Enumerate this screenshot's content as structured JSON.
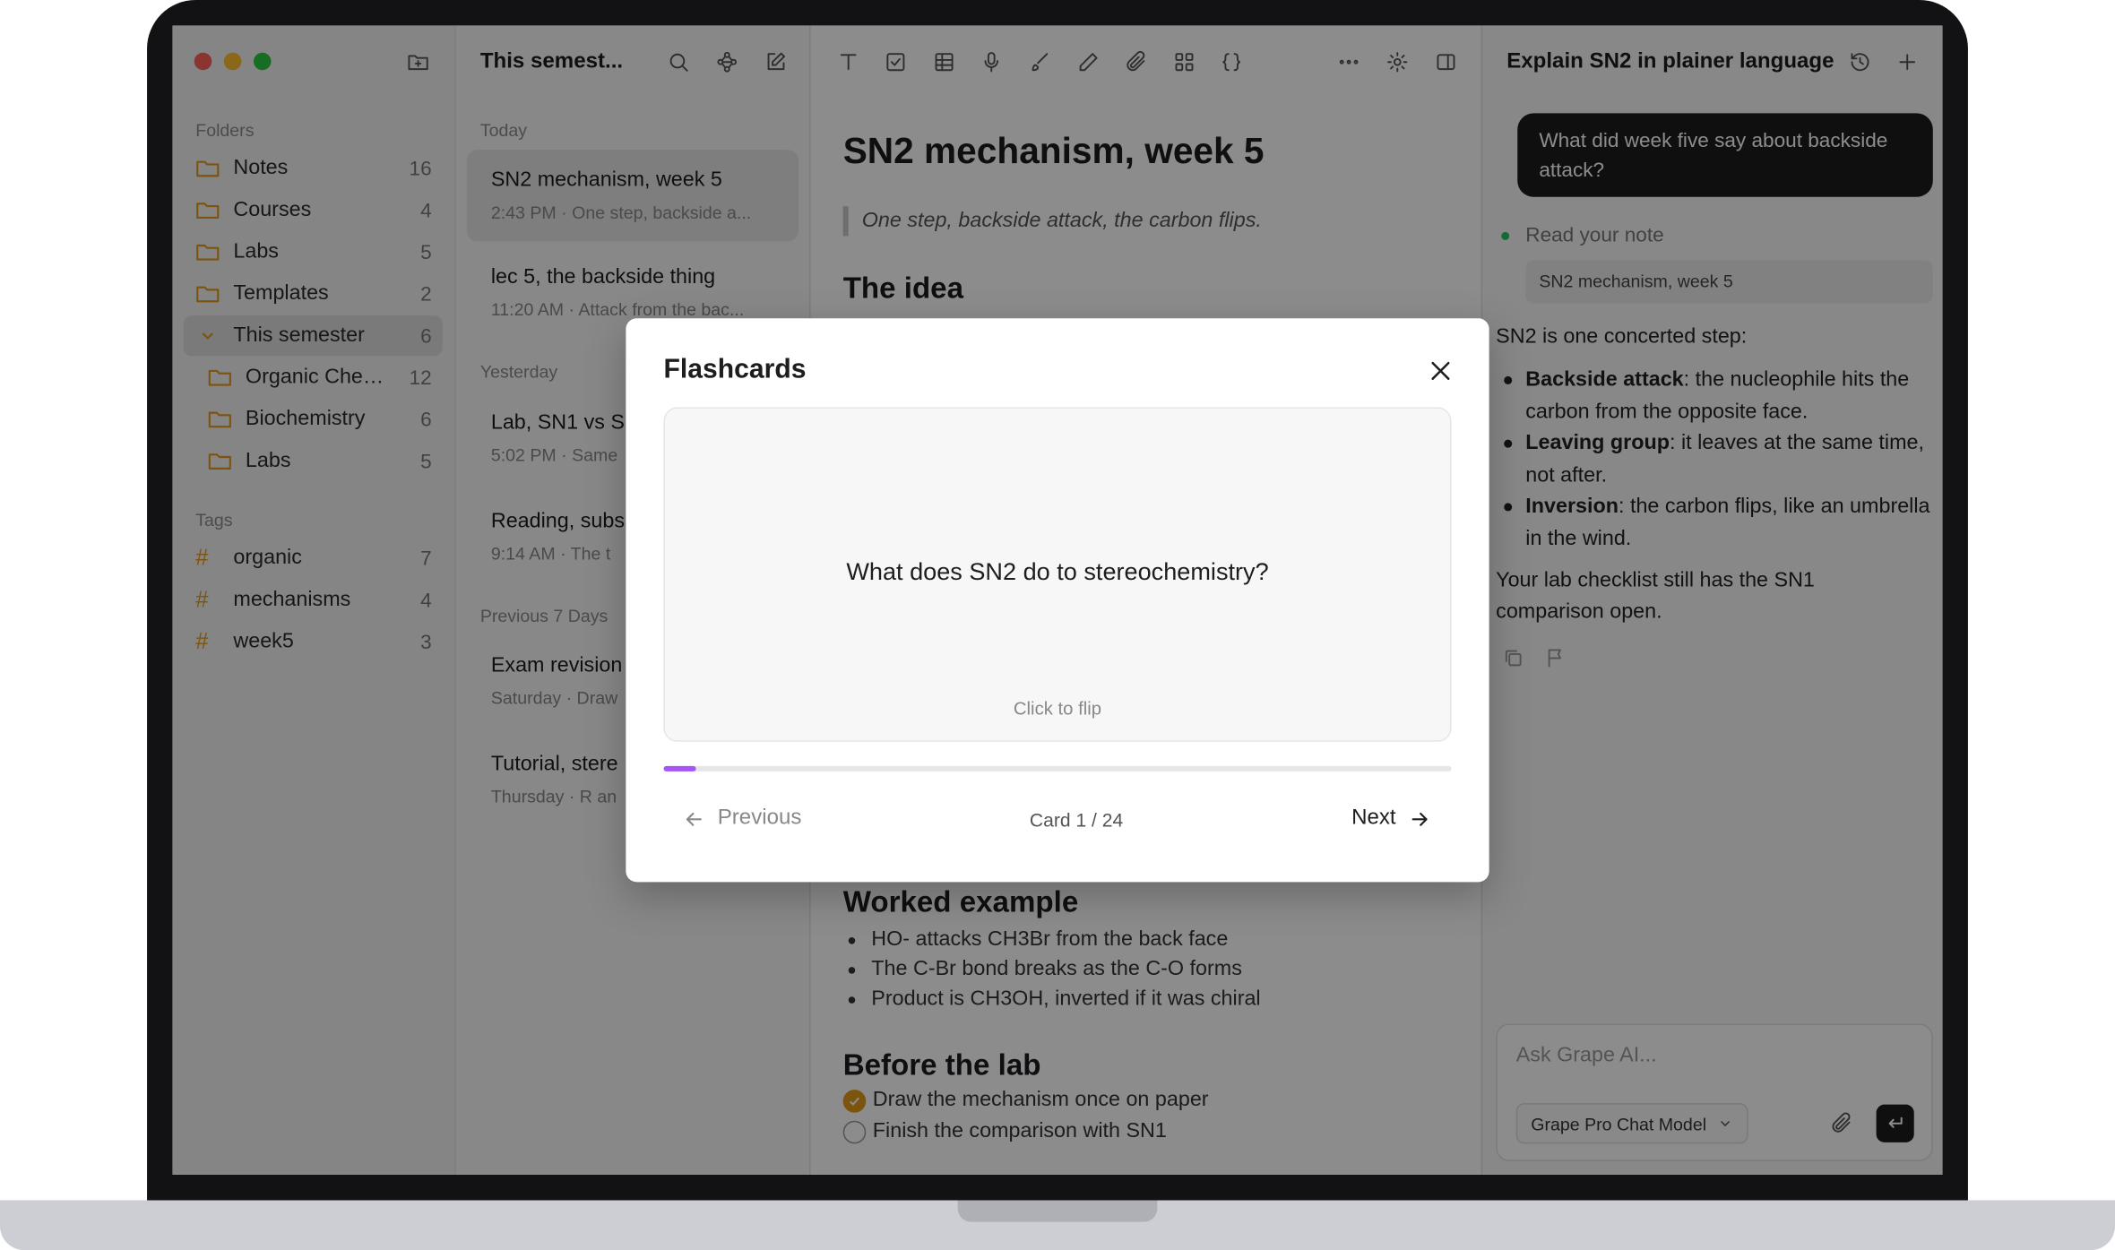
{
  "window": {
    "title": "This semest..."
  },
  "sidebar": {
    "folders_label": "Folders",
    "folders": [
      {
        "name": "Notes",
        "count": "16"
      },
      {
        "name": "Courses",
        "count": "4"
      },
      {
        "name": "Labs",
        "count": "5"
      },
      {
        "name": "Templates",
        "count": "2"
      },
      {
        "name": "This semester",
        "count": "6"
      },
      {
        "name": "Organic Chemi...",
        "count": "12"
      },
      {
        "name": "Biochemistry",
        "count": "6"
      },
      {
        "name": "Labs",
        "count": "5"
      }
    ],
    "tags_label": "Tags",
    "tags": [
      {
        "name": "organic",
        "count": "7"
      },
      {
        "name": "mechanisms",
        "count": "4"
      },
      {
        "name": "week5",
        "count": "3"
      }
    ]
  },
  "notes": {
    "groups": [
      "Today",
      "Yesterday",
      "Previous 7 Days"
    ],
    "items": [
      {
        "title": "SN2 mechanism, week 5",
        "meta": "2:43 PM · One step, backside a..."
      },
      {
        "title": "lec 5, the backside thing",
        "meta": "11:20 AM · Attack from the bac..."
      },
      {
        "title": "Lab, SN1 vs S",
        "meta": "5:02 PM · Same"
      },
      {
        "title": "Reading, subs",
        "meta": "9:14 AM · The t"
      },
      {
        "title": "Exam revision",
        "meta": "Saturday · Draw"
      },
      {
        "title": "Tutorial, stere",
        "meta": "Thursday · R an"
      }
    ]
  },
  "editor": {
    "title": "SN2 mechanism, week 5",
    "quote": "One step, backside attack, the carbon flips.",
    "h_idea": "The idea",
    "h_worked": "Worked example",
    "worked": [
      "HO- attacks CH3Br from the back face",
      "The C-Br bond breaks as the C-O forms",
      "Product is CH3OH, inverted if it was chiral"
    ],
    "h_before": "Before the lab",
    "checklist": [
      {
        "text": "Draw the mechanism once on paper",
        "done": true
      },
      {
        "text": "Finish the comparison with SN1",
        "done": false
      }
    ]
  },
  "chat": {
    "title": "Explain SN2 in plainer language",
    "user_msg": "What did week five say about backside attack?",
    "tool_label": "Read your note",
    "tool_ref": "SN2 mechanism, week 5",
    "intro": "SN2 is one concerted step:",
    "bullets": [
      {
        "b": "Backside attack",
        "t": ": the nucleophile hits the carbon from the opposite face."
      },
      {
        "b": "Leaving group",
        "t": ": it leaves at the same time, not after."
      },
      {
        "b": "Inversion",
        "t": ": the carbon flips, like an umbrella in the wind."
      }
    ],
    "outro": "Your lab checklist still has the SN1 comparison open.",
    "input_placeholder": "Ask Grape AI...",
    "model": "Grape Pro Chat Model"
  },
  "modal": {
    "title": "Flashcards",
    "question": "What does SN2 do to stereochemistry?",
    "hint": "Click to flip",
    "prev_label": "Previous",
    "next_label": "Next",
    "counter": "Card 1 / 24",
    "progress": 0.0417,
    "accent": "#a855f7"
  },
  "colors": {
    "folder": "#e49a19",
    "dot_red": "#ff5f57",
    "dot_yellow": "#febc2e",
    "dot_green": "#28c840",
    "status_green": "#22c55e"
  }
}
